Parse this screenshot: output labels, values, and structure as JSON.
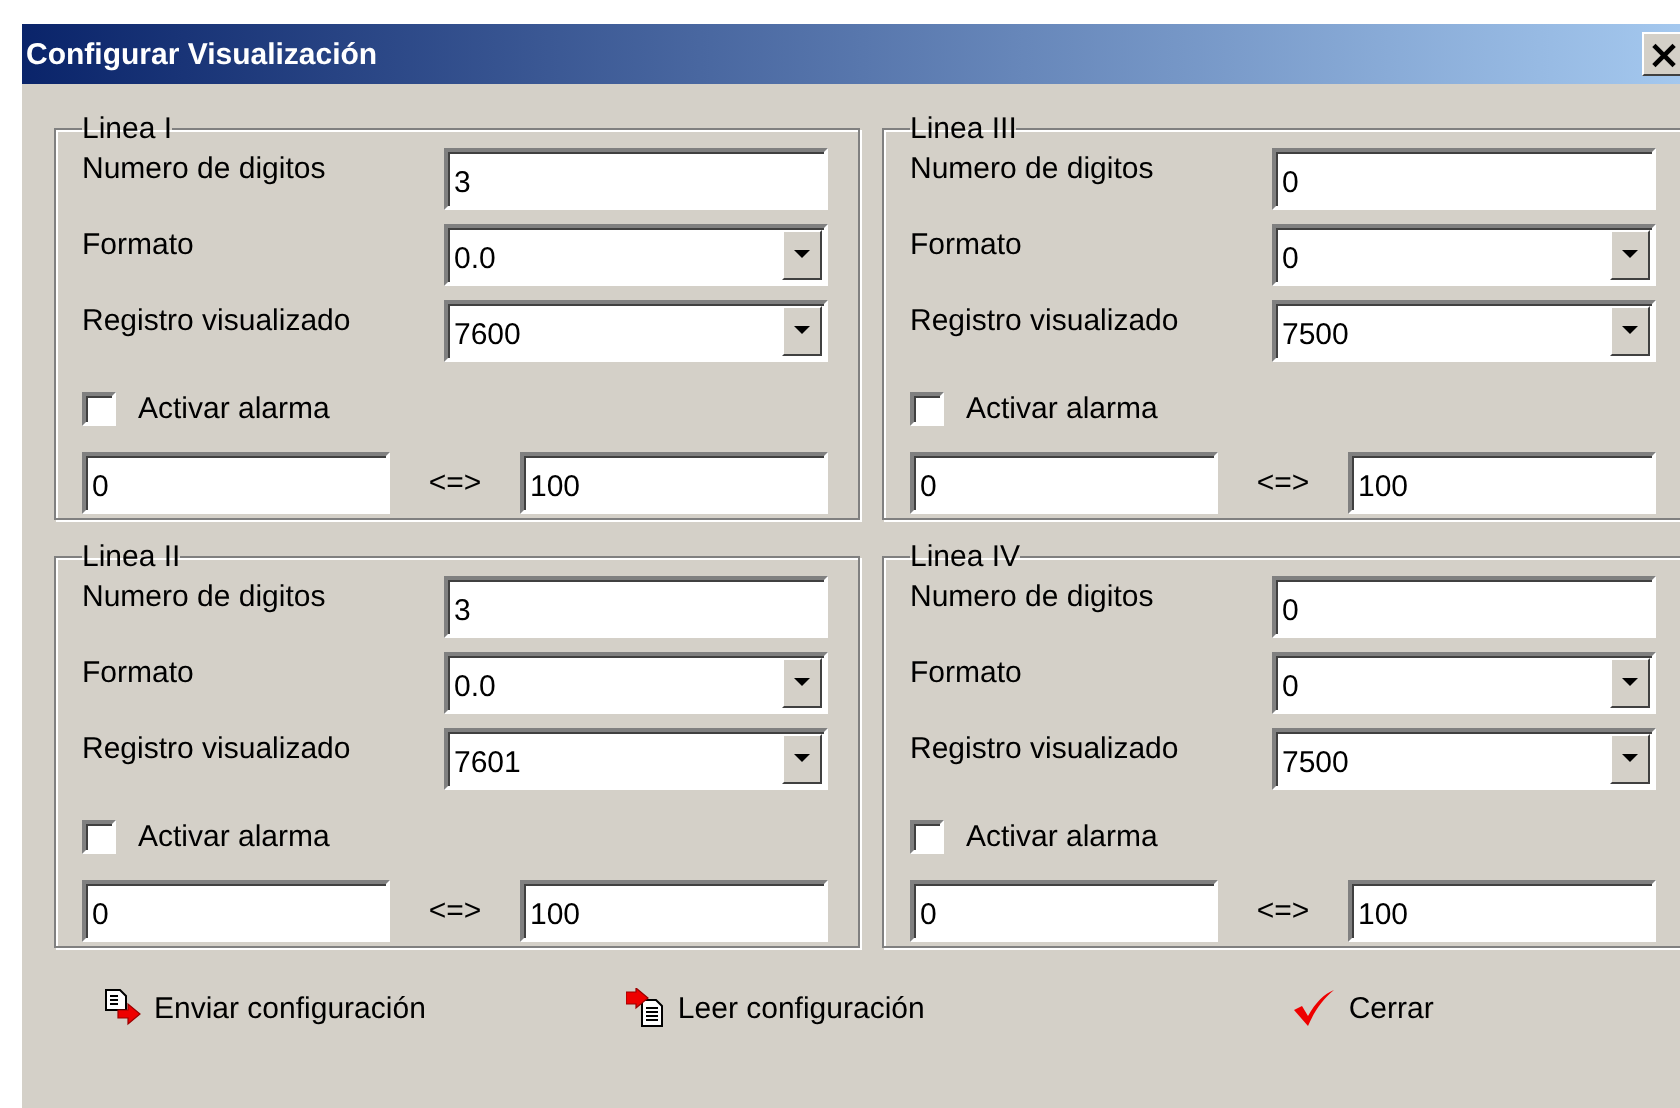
{
  "window": {
    "title": "Configurar Visualización",
    "close": "×"
  },
  "groups": [
    {
      "title": "Linea I",
      "digits_label": "Numero de digitos",
      "digits": "3",
      "format_label": "Formato",
      "format": "0.0",
      "register_label": "Registro visualizado",
      "register": "7600",
      "alarm": {
        "label": "Activar alarma",
        "checked": false
      },
      "min": "0",
      "separator": "<=>",
      "max": "100"
    },
    {
      "title": "Linea III",
      "digits_label": "Numero de digitos",
      "digits": "0",
      "format_label": "Formato",
      "format": "0",
      "register_label": "Registro visualizado",
      "register": "7500",
      "alarm": {
        "label": "Activar alarma",
        "checked": false
      },
      "min": "0",
      "separator": "<=>",
      "max": "100"
    },
    {
      "title": "Linea II",
      "digits_label": "Numero de digitos",
      "digits": "3",
      "format_label": "Formato",
      "format": "0.0",
      "register_label": "Registro visualizado",
      "register": "7601",
      "alarm": {
        "label": "Activar alarma",
        "checked": false
      },
      "min": "0",
      "separator": "<=>",
      "max": "100"
    },
    {
      "title": "Linea IV",
      "digits_label": "Numero de digitos",
      "digits": "0",
      "format_label": "Formato",
      "format": "0",
      "register_label": "Registro visualizado",
      "register": "7500",
      "alarm": {
        "label": "Activar alarma",
        "checked": false
      },
      "min": "0",
      "separator": "<=>",
      "max": "100"
    }
  ],
  "buttons": [
    {
      "kind": "send",
      "label": "Enviar configuración"
    },
    {
      "kind": "read",
      "label": "Leer configuración"
    },
    {
      "kind": "close",
      "label": "Cerrar"
    }
  ]
}
